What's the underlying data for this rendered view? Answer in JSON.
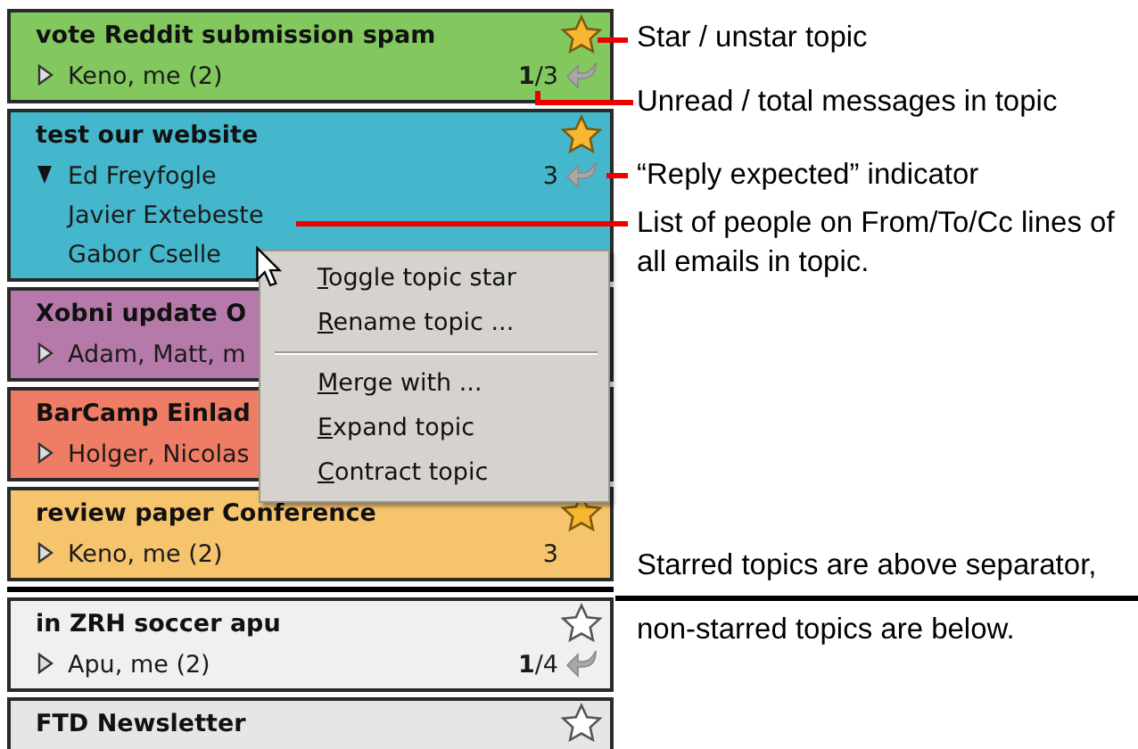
{
  "topics": [
    {
      "title": "vote Reddit submission spam",
      "color": "#82c85e",
      "starred": true,
      "expanded": false,
      "people": [
        "Keno, me (2)"
      ],
      "count": "**1**/3",
      "reply_expected": true
    },
    {
      "title": "test our website",
      "color": "#45b7cc",
      "starred": true,
      "expanded": true,
      "people": [
        "Ed Freyfogle",
        "Javier Extebeste",
        "Gabor Cselle"
      ],
      "count": "3",
      "reply_expected": true
    },
    {
      "title": "Xobni update O",
      "color": "#b57aaa",
      "expanded": false,
      "people": [
        "Adam, Matt, m"
      ]
    },
    {
      "title": "BarCamp Einlad",
      "color": "#ef7c64",
      "expanded": false,
      "people": [
        "Holger, Nicolas"
      ]
    },
    {
      "title": "review paper Conference",
      "color": "#f5c46c",
      "starred": true,
      "expanded": false,
      "people": [
        "Keno, me (2)"
      ],
      "count": "3",
      "reply_expected": false
    },
    {
      "separator": true
    },
    {
      "title": "in ZRH soccer apu",
      "color": "#f0f0f0",
      "starred": false,
      "expanded": false,
      "people": [
        "Apu, me (2)"
      ],
      "count": "**1**/4",
      "reply_expected": true
    },
    {
      "title": "FTD Newsletter",
      "color": "#e6e6e6",
      "starred": false
    }
  ],
  "context_menu": [
    {
      "label": "Toggle topic star",
      "kind": "item"
    },
    {
      "label": "Rename topic ...",
      "kind": "item"
    },
    {
      "kind": "separator"
    },
    {
      "label": "Merge with ...",
      "kind": "item"
    },
    {
      "label": "Expand topic",
      "kind": "item"
    },
    {
      "label": "Contract topic",
      "kind": "item"
    }
  ],
  "annotations": [
    {
      "text": "Star / unstar topic",
      "kind": "callout"
    },
    {
      "text": "Unread / total messages in topic",
      "kind": "callout"
    },
    {
      "text": "“Reply expected” indicator",
      "kind": "callout"
    },
    {
      "text": "List of people on From/To/Cc lines of all emails in topic.",
      "kind": "callout"
    },
    {
      "text_above": "Starred topics are above separator,",
      "text_below": "non-starred topics are below.",
      "kind": "separator_note"
    }
  ]
}
